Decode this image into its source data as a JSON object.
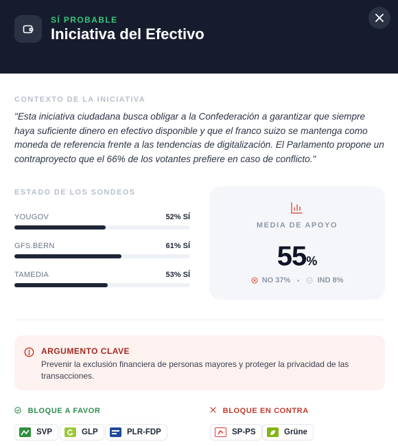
{
  "header": {
    "kicker": "SÍ PROBABLE",
    "title": "Iniciativa del Efectivo",
    "icon": "wallet-icon",
    "close_icon": "close-icon"
  },
  "context": {
    "label": "CONTEXTO DE LA INICIATIVA",
    "text": "\"Esta iniciativa ciudadana busca obligar a la Confederación a garantizar que siempre haya suficiente dinero en efectivo disponible y que el franco suizo se mantenga como moneda de referencia frente a las tendencias de digitalización. El Parlamento propone un contraproyecto que el 66% de los votantes prefiere en caso de conflicto.\""
  },
  "polls": {
    "label": "ESTADO DE LOS SONDEOS",
    "items": [
      {
        "name": "YOUGOV",
        "value_label": "52% SÍ",
        "fill": 0.52
      },
      {
        "name": "GFS.BERN",
        "value_label": "61% SÍ",
        "fill": 0.61
      },
      {
        "name": "TAMEDIA",
        "value_label": "53% SÍ",
        "fill": 0.53
      }
    ]
  },
  "support": {
    "label": "MEDIA DE APOYO",
    "value": "55",
    "unit": "%",
    "no_label": "NO 37%",
    "ind_label": "IND 8%",
    "icon": "bar-chart-icon"
  },
  "argument": {
    "title": "ARGUMENTO CLAVE",
    "text": "Prevenir la exclusión financiera de personas mayores y proteger la privacidad de las transacciones.",
    "icon": "alert-circle-icon"
  },
  "blocs": {
    "for": {
      "title": "BLOQUE A FAVOR",
      "parties": [
        "SVP",
        "GLP",
        "PLR-FDP"
      ]
    },
    "against": {
      "title": "BLOQUE EN CONTRA",
      "parties": [
        "SP-PS",
        "Grüne"
      ]
    }
  },
  "colors": {
    "header_bg": "#161c2e",
    "accent_green": "#34c77b",
    "accent_red": "#c0392b",
    "bar_fill": "#1e2536"
  }
}
